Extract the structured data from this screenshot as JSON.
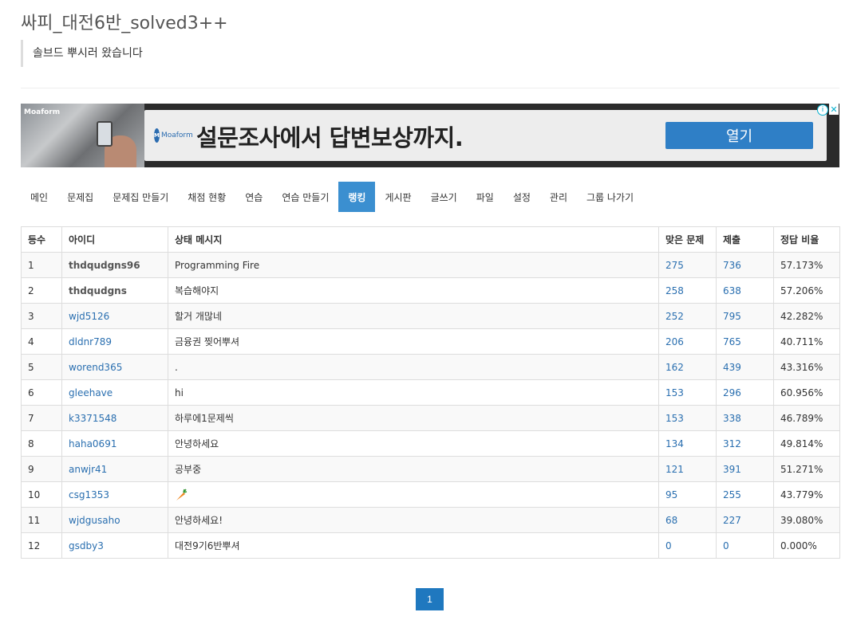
{
  "group": {
    "title": "싸피_대전6반_solved3++",
    "description": "솔브드 뿌시러 왔습니다"
  },
  "ad": {
    "brand": "Moaform",
    "headline": "설문조사에서 답변보상까지.",
    "cta": "열기",
    "info_symbol": "ⓘ",
    "close_symbol": "✕"
  },
  "nav": {
    "items": [
      {
        "label": "메인",
        "active": false
      },
      {
        "label": "문제집",
        "active": false
      },
      {
        "label": "문제집 만들기",
        "active": false
      },
      {
        "label": "채점 현황",
        "active": false
      },
      {
        "label": "연습",
        "active": false
      },
      {
        "label": "연습 만들기",
        "active": false
      },
      {
        "label": "랭킹",
        "active": true
      },
      {
        "label": "게시판",
        "active": false
      },
      {
        "label": "글쓰기",
        "active": false
      },
      {
        "label": "파일",
        "active": false
      },
      {
        "label": "설정",
        "active": false
      },
      {
        "label": "관리",
        "active": false
      },
      {
        "label": "그룹 나가기",
        "active": false
      }
    ]
  },
  "table": {
    "headers": [
      "등수",
      "아이디",
      "상태 메시지",
      "맞은 문제",
      "제출",
      "정답 비율"
    ],
    "rows": [
      {
        "rank": "1",
        "id": "thdqudgns96",
        "id_style": "bold",
        "status": "Programming Fire",
        "solved": "275",
        "submissions": "736",
        "ratio": "57.173%"
      },
      {
        "rank": "2",
        "id": "thdqudgns",
        "id_style": "bold",
        "status": "복습해야지",
        "solved": "258",
        "submissions": "638",
        "ratio": "57.206%"
      },
      {
        "rank": "3",
        "id": "wjd5126",
        "id_style": "link",
        "status": "할거 개많네",
        "solved": "252",
        "submissions": "795",
        "ratio": "42.282%"
      },
      {
        "rank": "4",
        "id": "dldnr789",
        "id_style": "link",
        "status": "금융권 찢어뿌셔",
        "solved": "206",
        "submissions": "765",
        "ratio": "40.711%"
      },
      {
        "rank": "5",
        "id": "worend365",
        "id_style": "link",
        "status": ".",
        "solved": "162",
        "submissions": "439",
        "ratio": "43.316%"
      },
      {
        "rank": "6",
        "id": "gleehave",
        "id_style": "link",
        "status": "hi",
        "solved": "153",
        "submissions": "296",
        "ratio": "60.956%"
      },
      {
        "rank": "7",
        "id": "k3371548",
        "id_style": "link",
        "status": "하루에1문제씩",
        "solved": "153",
        "submissions": "338",
        "ratio": "46.789%"
      },
      {
        "rank": "8",
        "id": "haha0691",
        "id_style": "link",
        "status": "안녕하세요",
        "solved": "134",
        "submissions": "312",
        "ratio": "49.814%"
      },
      {
        "rank": "9",
        "id": "anwjr41",
        "id_style": "link",
        "status": "공부중",
        "solved": "121",
        "submissions": "391",
        "ratio": "51.271%"
      },
      {
        "rank": "10",
        "id": "csg1353",
        "id_style": "link",
        "status": "",
        "status_icon": "carrot-icon",
        "solved": "95",
        "submissions": "255",
        "ratio": "43.779%"
      },
      {
        "rank": "11",
        "id": "wjdgusaho",
        "id_style": "link",
        "status": "안녕하세요!",
        "solved": "68",
        "submissions": "227",
        "ratio": "39.080%"
      },
      {
        "rank": "12",
        "id": "gsdby3",
        "id_style": "link",
        "status": "대전9기6반뿌셔",
        "solved": "0",
        "submissions": "0",
        "ratio": "0.000%"
      }
    ]
  },
  "pagination": {
    "current": "1"
  },
  "colors": {
    "accent": "#3b8fd0",
    "link": "#2a6fb0",
    "ad_cta": "#2f7fc6"
  }
}
